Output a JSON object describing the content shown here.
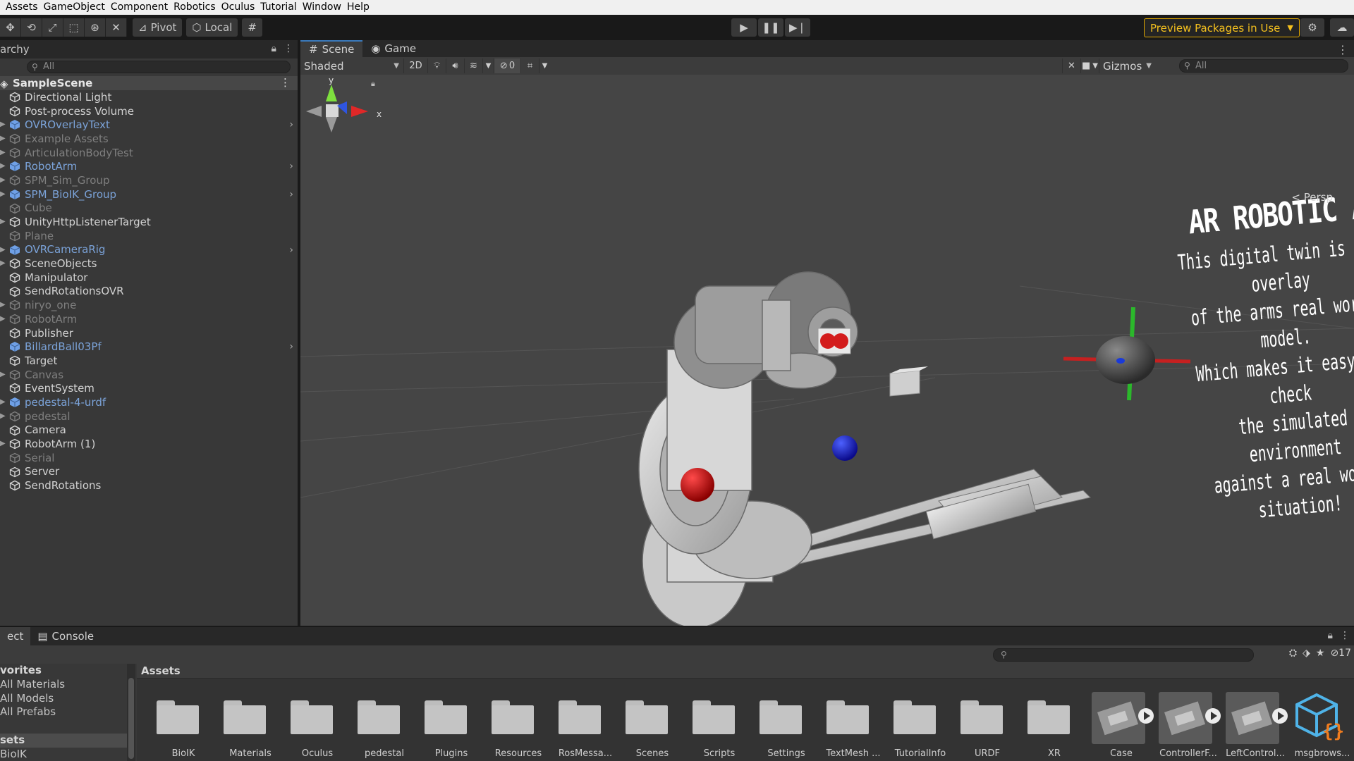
{
  "menu": [
    "Assets",
    "GameObject",
    "Component",
    "Robotics",
    "Oculus",
    "Tutorial",
    "Window",
    "Help"
  ],
  "toolbar": {
    "transform_tools": [
      "move-tool-icon",
      "rotate-tool-icon",
      "scale-tool-icon",
      "rect-tool-icon",
      "transform-tool-icon",
      "custom-tool-icon"
    ],
    "pivot_label": "Pivot",
    "local_label": "Local",
    "preview_packages_label": "Preview Packages in Use",
    "accent_color": "#f4c01e"
  },
  "hierarchy": {
    "tab_label": "archy",
    "search_placeholder": "All",
    "scene_name": "SampleScene",
    "items": [
      {
        "label": "Directional Light",
        "state": "normal",
        "expand": false,
        "chevron": false,
        "prefab": false
      },
      {
        "label": "Post-process Volume",
        "state": "normal",
        "expand": false,
        "chevron": false,
        "prefab": false
      },
      {
        "label": "OVROverlayText",
        "state": "prefab",
        "expand": true,
        "chevron": true,
        "prefab": true
      },
      {
        "label": "Example Assets",
        "state": "disabled",
        "expand": true,
        "chevron": false,
        "prefab": false
      },
      {
        "label": "ArticulationBodyTest",
        "state": "disabled",
        "expand": true,
        "chevron": false,
        "prefab": false
      },
      {
        "label": "RobotArm",
        "state": "prefab",
        "expand": true,
        "chevron": true,
        "prefab": true
      },
      {
        "label": "SPM_Sim_Group",
        "state": "disabled",
        "expand": true,
        "chevron": false,
        "prefab": false
      },
      {
        "label": "SPM_BioIK_Group",
        "state": "prefab",
        "expand": true,
        "chevron": true,
        "prefab": true
      },
      {
        "label": "Cube",
        "state": "disabled",
        "expand": false,
        "chevron": false,
        "prefab": false
      },
      {
        "label": "UnityHttpListenerTarget",
        "state": "normal",
        "expand": true,
        "chevron": false,
        "prefab": false
      },
      {
        "label": "Plane",
        "state": "disabled",
        "expand": false,
        "chevron": false,
        "prefab": false
      },
      {
        "label": "OVRCameraRig",
        "state": "prefab",
        "expand": true,
        "chevron": true,
        "prefab": true
      },
      {
        "label": "SceneObjects",
        "state": "normal",
        "expand": true,
        "chevron": false,
        "prefab": false
      },
      {
        "label": "Manipulator",
        "state": "normal",
        "expand": false,
        "chevron": false,
        "prefab": false
      },
      {
        "label": "SendRotationsOVR",
        "state": "normal",
        "expand": false,
        "chevron": false,
        "prefab": false
      },
      {
        "label": "niryo_one",
        "state": "disabled",
        "expand": true,
        "chevron": false,
        "prefab": false
      },
      {
        "label": "RobotArm",
        "state": "disabled",
        "expand": true,
        "chevron": false,
        "prefab": false
      },
      {
        "label": "Publisher",
        "state": "normal",
        "expand": false,
        "chevron": false,
        "prefab": false
      },
      {
        "label": "BillardBall03Pf",
        "state": "prefab",
        "expand": false,
        "chevron": true,
        "prefab": true
      },
      {
        "label": "Target",
        "state": "normal",
        "expand": false,
        "chevron": false,
        "prefab": false
      },
      {
        "label": "Canvas",
        "state": "disabled",
        "expand": true,
        "chevron": false,
        "prefab": false
      },
      {
        "label": "EventSystem",
        "state": "normal",
        "expand": false,
        "chevron": false,
        "prefab": false
      },
      {
        "label": "pedestal-4-urdf",
        "state": "prefab",
        "expand": true,
        "chevron": false,
        "prefab": true
      },
      {
        "label": "pedestal",
        "state": "disabled",
        "expand": true,
        "chevron": false,
        "prefab": false
      },
      {
        "label": "Camera",
        "state": "normal",
        "expand": false,
        "chevron": false,
        "prefab": false
      },
      {
        "label": "RobotArm (1)",
        "state": "normal",
        "expand": true,
        "chevron": false,
        "prefab": false
      },
      {
        "label": "Serial",
        "state": "disabled",
        "expand": false,
        "chevron": false,
        "prefab": false
      },
      {
        "label": "Server",
        "state": "normal",
        "expand": false,
        "chevron": false,
        "prefab": false
      },
      {
        "label": "SendRotations",
        "state": "normal",
        "expand": false,
        "chevron": false,
        "prefab": false
      }
    ]
  },
  "scene_view": {
    "tabs": [
      {
        "label": "Scene",
        "icon": "hash-icon"
      },
      {
        "label": "Game",
        "icon": "gamepad-icon"
      }
    ],
    "shading_mode": "Shaded",
    "mode_2d_label": "2D",
    "hidden_count": "0",
    "gizmos_label": "Gizmos",
    "search_placeholder": "All",
    "projection_label": "Persp",
    "axis_y": "y",
    "axis_x": "x",
    "overlay_title": "AR ROBOTIC ARM",
    "overlay_lines": [
      "This digital twin is the overlay",
      "of the arms real world model.",
      "Which makes it easy to check",
      "the simulated environment",
      "against a real world situation!"
    ]
  },
  "bottom": {
    "tabs": [
      "ect",
      "Console"
    ],
    "hidden_count": "17",
    "tree": [
      {
        "label": "vorites",
        "type": "head"
      },
      {
        "label": "All Materials",
        "type": "item"
      },
      {
        "label": "All Models",
        "type": "item"
      },
      {
        "label": "All Prefabs",
        "type": "item"
      },
      {
        "label": "",
        "type": "gap"
      },
      {
        "label": "sets",
        "type": "head-sel"
      },
      {
        "label": "BioIK",
        "type": "item"
      }
    ],
    "assets_header": "Assets",
    "assets": [
      {
        "label": "BioIK",
        "kind": "folder"
      },
      {
        "label": "Materials",
        "kind": "folder"
      },
      {
        "label": "Oculus",
        "kind": "folder"
      },
      {
        "label": "pedestal",
        "kind": "folder"
      },
      {
        "label": "Plugins",
        "kind": "folder"
      },
      {
        "label": "Resources",
        "kind": "folder"
      },
      {
        "label": "RosMessa...",
        "kind": "folder"
      },
      {
        "label": "Scenes",
        "kind": "folder"
      },
      {
        "label": "Scripts",
        "kind": "folder"
      },
      {
        "label": "Settings",
        "kind": "folder"
      },
      {
        "label": "TextMesh ...",
        "kind": "folder"
      },
      {
        "label": "TutorialInfo",
        "kind": "folder"
      },
      {
        "label": "URDF",
        "kind": "folder"
      },
      {
        "label": "XR",
        "kind": "folder"
      },
      {
        "label": "Case",
        "kind": "model"
      },
      {
        "label": "ControllerF...",
        "kind": "model"
      },
      {
        "label": "LeftControl...",
        "kind": "model"
      },
      {
        "label": "msgbrows...",
        "kind": "script"
      }
    ]
  }
}
